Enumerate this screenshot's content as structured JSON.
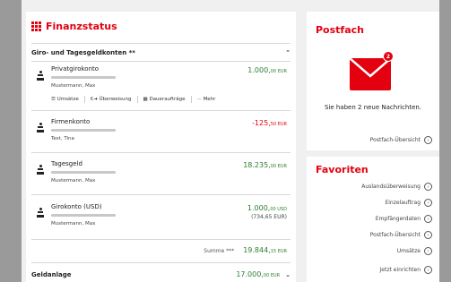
{
  "finanzstatus": {
    "title": "Finanzstatus",
    "section_title": "Giro- und Tagesgeldkonten **",
    "accounts": [
      {
        "name": "Privatgirokonto",
        "owner": "Mustermann, Max",
        "amount": "1.000,",
        "amount_small": "00 EUR",
        "sign": "positive"
      },
      {
        "name": "Firmenkonto",
        "owner": "Test, Tina",
        "amount": "-125,",
        "amount_small": "50 EUR",
        "sign": "negative"
      },
      {
        "name": "Tagesgeld",
        "owner": "Mustermann, Max",
        "amount": "18.235,",
        "amount_small": "00 EUR",
        "sign": "positive"
      },
      {
        "name": "Girokonto (USD)",
        "owner": "Mustermann, Max",
        "amount": "1.000,",
        "amount_small": "00 USD",
        "amount_secondary": "(734,65 EUR)",
        "sign": "positive"
      }
    ],
    "actions": {
      "umsaetze": "Umsätze",
      "ueberweisung": "Überweisung",
      "dauerauftraege": "Daueraufträge",
      "mehr": "Mehr"
    },
    "summe_label": "Summe ***",
    "summe_value": "19.844,",
    "summe_small": "15 EUR",
    "geldanlage_label": "Geldanlage",
    "geldanlage_value": "17.000,",
    "geldanlage_small": "00 EUR"
  },
  "postfach": {
    "title": "Postfach",
    "badge_count": "2",
    "message": "Sie haben 2 neue Nachrichten.",
    "overview_link": "Postfach-Übersicht"
  },
  "favoriten": {
    "title": "Favoriten",
    "links": [
      "Auslandsüberweisung",
      "Einzelauftrag",
      "Empfängerdaten",
      "Postfach-Übersicht",
      "Umsätze"
    ],
    "setup_link": "Jetzt einrichten"
  },
  "colors": {
    "brand": "#e3000f",
    "positive": "#2e7d32",
    "background": "#f0f0f0"
  }
}
